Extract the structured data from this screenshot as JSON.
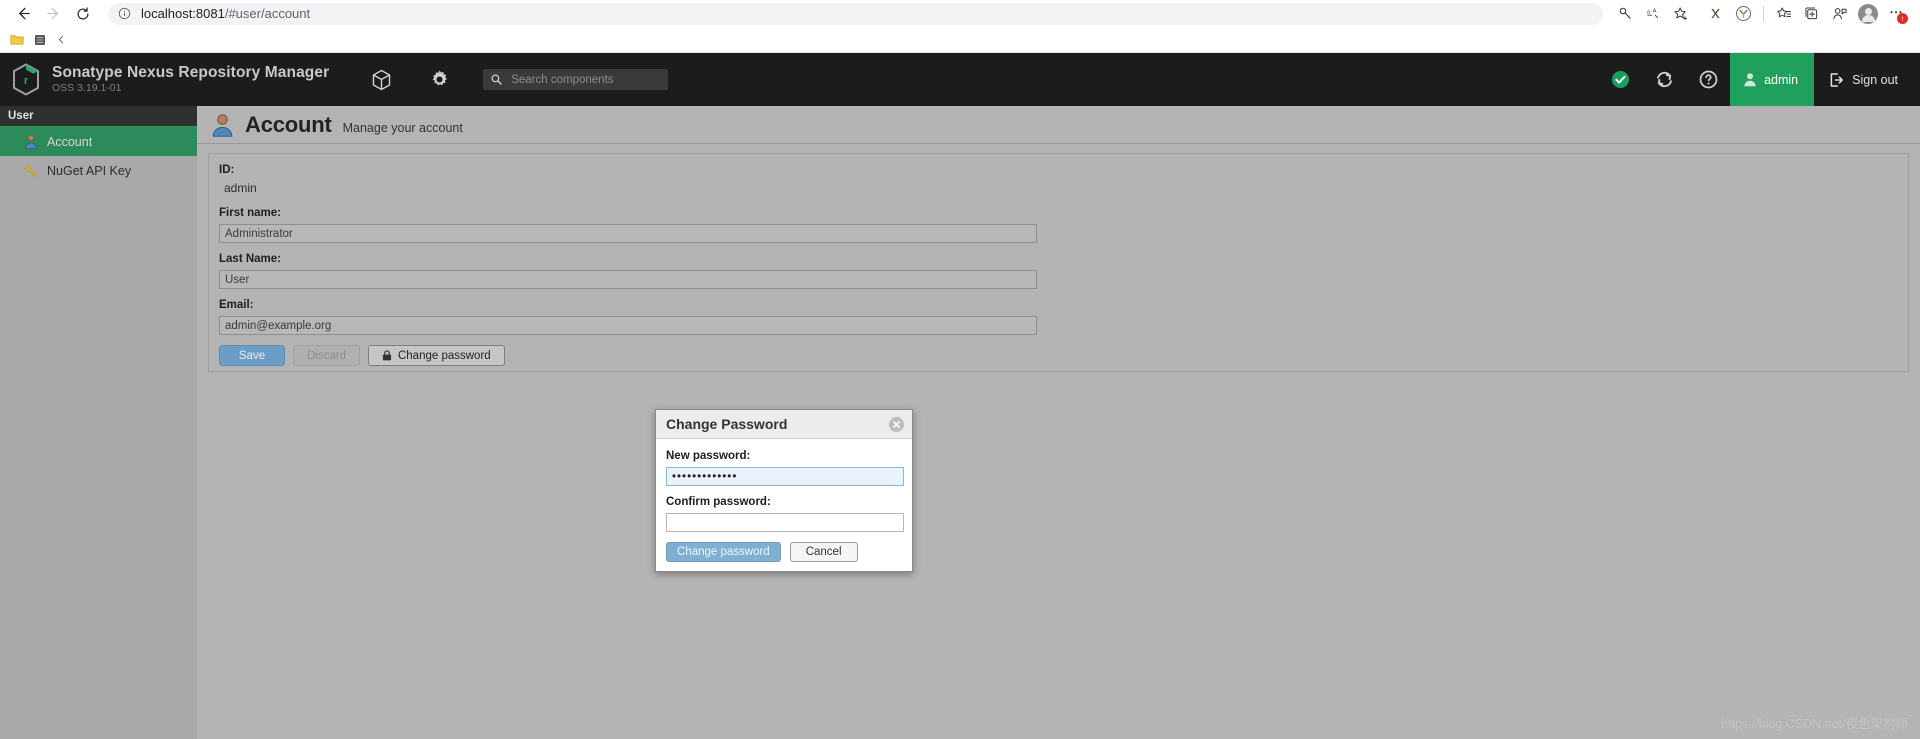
{
  "browser": {
    "nav": {
      "back_icon": "arrow-left-icon",
      "forward_icon": "arrow-right-icon",
      "reload_icon": "reload-icon"
    },
    "omnibox": {
      "info_icon": "info-circle-icon",
      "url_host": "localhost:8081",
      "url_path": "/#user/account",
      "url_full": "localhost:8081/#user/account"
    },
    "toolbar_icons": [
      {
        "name": "key-icon",
        "glyph": "⚷"
      },
      {
        "name": "translate-icon",
        "glyph": "文"
      },
      {
        "name": "bookmark-star-add-icon",
        "glyph": "☆"
      },
      {
        "name": "extension-x-icon",
        "glyph": "X"
      },
      {
        "name": "yandex-extension-icon",
        "glyph": "Y"
      },
      {
        "name": "collections-star-icon",
        "glyph": "☆"
      },
      {
        "name": "tab-group-add-icon",
        "glyph": "⧉"
      },
      {
        "name": "profile-share-icon",
        "glyph": "☺"
      },
      {
        "name": "profile-avatar-icon",
        "glyph": ""
      },
      {
        "name": "browser-menu-icon",
        "glyph": "⋯"
      }
    ],
    "menu_badge": "↑",
    "bookmarks": [
      {
        "name": "bookmark-folder",
        "icon": "folder-icon",
        "label": ""
      },
      {
        "name": "bookmark-app",
        "icon": "app-icon",
        "label": ""
      },
      {
        "name": "bookmarks-overflow",
        "icon": "chevron-left-icon",
        "label": ""
      }
    ]
  },
  "nexus": {
    "brand": {
      "logo_icon": "nexus-logo-icon",
      "title": "Sonatype Nexus Repository Manager",
      "version": "OSS 3.19.1-01"
    },
    "header_icons": [
      {
        "name": "browse-cube-icon",
        "glyph": "cube"
      },
      {
        "name": "settings-gear-icon",
        "glyph": "gear"
      }
    ],
    "search": {
      "icon": "search-icon",
      "placeholder": "Search components",
      "value": ""
    },
    "right": {
      "status_icon": "status-ok-check-icon",
      "refresh_icon": "refresh-icon",
      "help_icon": "help-question-icon",
      "user_icon": "user-avatar-icon",
      "user_label": "admin",
      "signout_icon": "sign-out-icon",
      "signout_label": "Sign out"
    },
    "sidebar": {
      "section_title": "User",
      "items": [
        {
          "label": "Account",
          "icon": "user-account-icon",
          "active": true
        },
        {
          "label": "NuGet API Key",
          "icon": "key-icon",
          "active": false
        }
      ]
    },
    "page": {
      "icon": "user-account-icon",
      "title": "Account",
      "subtitle": "Manage your account"
    },
    "form": {
      "id_label": "ID:",
      "id_value": "admin",
      "first_name_label": "First name:",
      "first_name_value": "Administrator",
      "last_name_label": "Last Name:",
      "last_name_value": "User",
      "email_label": "Email:",
      "email_value": "admin@example.org",
      "save_label": "Save",
      "discard_label": "Discard",
      "change_password_label": "Change password",
      "change_password_icon": "lock-icon"
    },
    "modal": {
      "title": "Change Password",
      "close_icon": "close-circle-icon",
      "new_password_label": "New password:",
      "new_password_value": "•••••••••••••",
      "confirm_password_label": "Confirm password:",
      "confirm_password_value": "",
      "submit_label": "Change password",
      "cancel_label": "Cancel"
    }
  },
  "watermark": {
    "text": "https://blog.CSDN.net/夜色架构师"
  },
  "colors": {
    "nexus_green": "#20a05c",
    "header_dark": "#1c1c1c",
    "sidebar_gray": "#a9a9a9",
    "content_gray": "#b4b4b4",
    "primary_blue": "#6c9dc6",
    "focus_blue": "#8cb8e0"
  }
}
